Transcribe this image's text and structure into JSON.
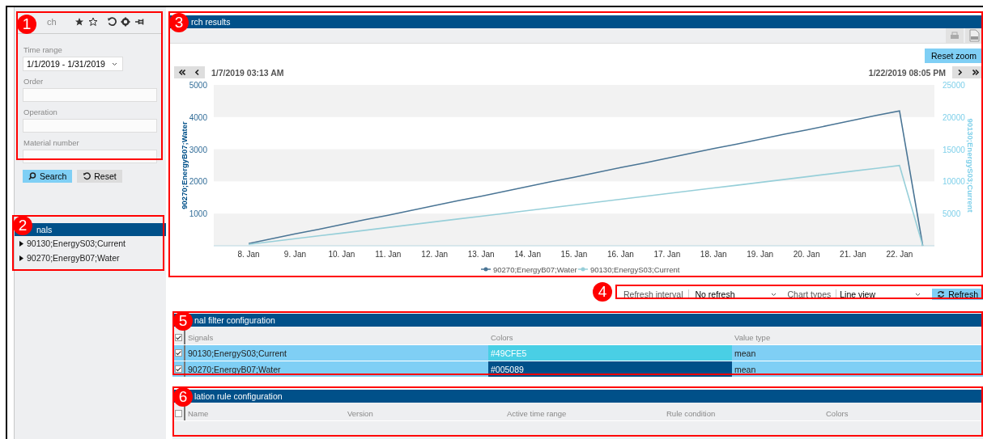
{
  "search_panel": {
    "title": "ch",
    "time_range": {
      "label": "Time range",
      "value": "1/1/2019 - 1/31/2019"
    },
    "fields": [
      {
        "label": "Order"
      },
      {
        "label": "Operation"
      },
      {
        "label": "Material number"
      }
    ],
    "buttons": [
      {
        "label": "Search",
        "kind": "primary"
      },
      {
        "label": "Reset",
        "kind": "secondary"
      }
    ]
  },
  "signals_panel": {
    "title": "nals",
    "items": [
      {
        "label": "90130;EnergyS03;Current",
        "expanded": false
      },
      {
        "label": "90270;EnergyB07;Water",
        "expanded": false
      }
    ]
  },
  "results": {
    "title": "rch results",
    "reset_zoom": "Reset zoom",
    "start": "1/7/2019 03:13 AM",
    "end": "1/22/2019 08:05 PM",
    "chart_data": {
      "type": "line",
      "ylabel": "90270;EnergyB07;Water",
      "y2label": "90130;EnergyS03;Current",
      "categories": [
        null,
        "8. Jan",
        null,
        "9. Jan",
        null,
        "10. Jan",
        null,
        "11. Jan",
        null,
        "12. Jan",
        null,
        "13. Jan",
        null,
        "14. Jan",
        null,
        "15. Jan",
        null,
        "16. Jan",
        null,
        "17. Jan",
        null,
        "18. Jan",
        null,
        "19. Jan",
        null,
        "20. Jan",
        null,
        "21. Jan",
        null,
        "22. Jan",
        null
      ],
      "ylim": [
        0,
        5000
      ],
      "yticks": [
        1000,
        2000,
        3000,
        4000,
        5000
      ],
      "y2lim": [
        0,
        25000
      ],
      "y2ticks": [
        5000,
        10000,
        15000,
        20000,
        25000
      ],
      "series": [
        {
          "name": "90270;EnergyB07;Water",
          "color": "#4a7595",
          "values": [
            null,
            70,
            220,
            370,
            510,
            660,
            810,
            950,
            1100,
            1250,
            1400,
            1540,
            1690,
            1840,
            1990,
            2130,
            2280,
            2430,
            2570,
            2720,
            2870,
            3020,
            3160,
            3310,
            3460,
            3600,
            3750,
            3900,
            4050,
            4190,
            0
          ]
        },
        {
          "name": "90130;EnergyS03;Current",
          "color": "#97cfd9",
          "axis": "y2",
          "values": [
            null,
            210,
            650,
            1090,
            1530,
            1960,
            2400,
            2840,
            3280,
            3720,
            4160,
            4590,
            5030,
            5470,
            5910,
            6350,
            6790,
            7220,
            7660,
            8100,
            8540,
            8980,
            9410,
            9850,
            10290,
            10730,
            11170,
            11610,
            12040,
            12480,
            0
          ]
        }
      ],
      "legend": "bottom"
    }
  },
  "controls": {
    "refresh_label": "Refresh interval",
    "refresh_value": "No refresh",
    "chart_type_label": "Chart types",
    "chart_type_value": "Line view",
    "refresh_button": "Refresh"
  },
  "signal_filter": {
    "title": "nal filter configuration",
    "all_checked": true,
    "columns": [
      "Signals",
      "Colors",
      "Value type"
    ],
    "rows": [
      {
        "checked": true,
        "selected": true,
        "signal": "90130;EnergyS03;Current",
        "color_text": "#49CFE5",
        "color": "#49cfe5",
        "value_type": "mean"
      },
      {
        "checked": true,
        "selected": true,
        "signal": "90270;EnergyB07;Water",
        "color_text": "#005089",
        "color": "#005089",
        "value_type": "mean"
      }
    ]
  },
  "violation_rules": {
    "title": "lation rule configuration",
    "all_checked": false,
    "columns": [
      "Name",
      "Version",
      "Active time range",
      "Rule condition",
      "Colors"
    ]
  },
  "callouts": [
    {
      "number": "1"
    },
    {
      "number": "2"
    },
    {
      "number": "3"
    },
    {
      "number": "4"
    },
    {
      "number": "5"
    },
    {
      "number": "6"
    }
  ]
}
